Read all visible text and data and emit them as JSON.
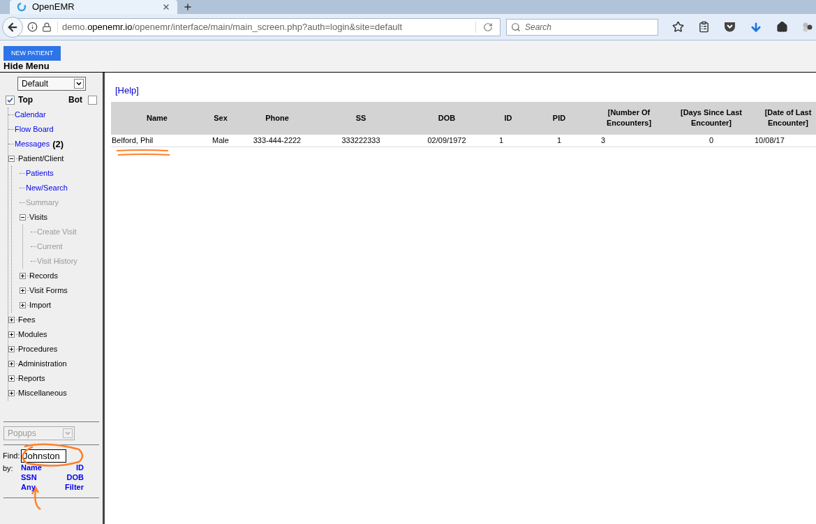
{
  "browser": {
    "tab_title": "OpenEMR",
    "url": {
      "prefix": "demo.",
      "domain": "openemr.io",
      "path": "/openemr/interface/main/main_screen.php?auth=login&site=default"
    },
    "search_placeholder": "Search"
  },
  "header": {
    "new_patient_button": "NEW PATIENT",
    "hide_menu": "Hide Menu"
  },
  "sidebar": {
    "layout_select": "Default",
    "top": {
      "label": "Top",
      "checked": true
    },
    "bot": {
      "label": "Bot",
      "checked": false
    },
    "tree": [
      {
        "label": "Calendar",
        "kind": "link",
        "disabled": false
      },
      {
        "label": "Flow Board",
        "kind": "link",
        "disabled": false
      },
      {
        "label": "Messages",
        "badge": "(2)",
        "kind": "link",
        "disabled": false
      },
      {
        "label": "Patient/Client",
        "kind": "folder",
        "expanded": true,
        "children": [
          {
            "label": "Patients",
            "kind": "link",
            "disabled": false
          },
          {
            "label": "New/Search",
            "kind": "link",
            "disabled": false
          },
          {
            "label": "Summary",
            "kind": "link",
            "disabled": true
          },
          {
            "label": "Visits",
            "kind": "folder",
            "expanded": true,
            "children": [
              {
                "label": "Create Visit",
                "kind": "link",
                "disabled": true
              },
              {
                "label": "Current",
                "kind": "link",
                "disabled": true
              },
              {
                "label": "Visit History",
                "kind": "link",
                "disabled": true
              }
            ]
          },
          {
            "label": "Records",
            "kind": "folder",
            "expanded": false
          },
          {
            "label": "Visit Forms",
            "kind": "folder",
            "expanded": false
          },
          {
            "label": "Import",
            "kind": "folder",
            "expanded": false
          }
        ]
      },
      {
        "label": "Fees",
        "kind": "folder",
        "expanded": false
      },
      {
        "label": "Modules",
        "kind": "folder",
        "expanded": false
      },
      {
        "label": "Procedures",
        "kind": "folder",
        "expanded": false
      },
      {
        "label": "Administration",
        "kind": "folder",
        "expanded": false
      },
      {
        "label": "Reports",
        "kind": "folder",
        "expanded": false
      },
      {
        "label": "Miscellaneous",
        "kind": "folder",
        "expanded": false
      }
    ],
    "popups_select": {
      "value": "Popups",
      "disabled": true
    },
    "find": {
      "label": "Find:",
      "value": "Johnston",
      "by_label": "by:",
      "links": [
        "Name",
        "ID",
        "SSN",
        "DOB",
        "Any",
        "Filter"
      ]
    }
  },
  "content": {
    "help_link": "[Help]",
    "table": {
      "columns": [
        "Name",
        "Sex",
        "Phone",
        "SS",
        "DOB",
        "ID",
        "PID",
        "[Number Of Encounters]",
        "[Days Since Last Encounter]",
        "[Date of Last Encounter]"
      ],
      "rows": [
        [
          "Belford, Phil",
          "Male",
          "333-444-2222",
          "333222333",
          "02/09/1972",
          "1",
          "1",
          "3",
          "0",
          "10/08/17"
        ]
      ]
    }
  }
}
